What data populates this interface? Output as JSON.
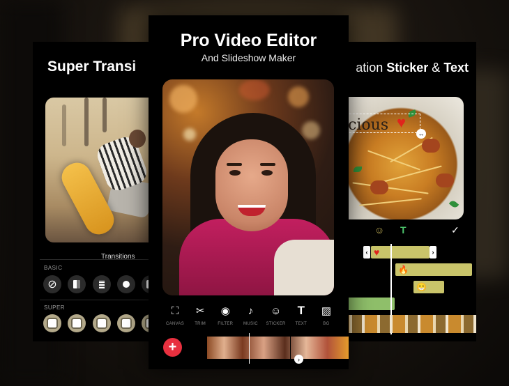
{
  "left_card": {
    "title": "Super Transi",
    "transitions_label": "Transitions",
    "basic_label": "BASIC",
    "super_label": "SUPER"
  },
  "center_card": {
    "title": "Pro Video Editor",
    "subtitle": "And Slideshow Maker",
    "toolbar": [
      {
        "label": "CANVAS",
        "icon": "canvas-icon",
        "glyph": "⛶"
      },
      {
        "label": "TRIM",
        "icon": "scissors-icon",
        "glyph": "✂"
      },
      {
        "label": "FILTER",
        "icon": "filter-icon",
        "glyph": "◉"
      },
      {
        "label": "MUSIC",
        "icon": "music-note-icon",
        "glyph": "♪"
      },
      {
        "label": "STICKER",
        "icon": "smiley-icon",
        "glyph": "☺"
      },
      {
        "label": "TEXT",
        "icon": "text-icon",
        "glyph": "T"
      },
      {
        "label": "BG",
        "icon": "background-pattern-icon",
        "glyph": "▨"
      }
    ],
    "add_glyph": "+",
    "next_glyph": "›"
  },
  "right_card": {
    "title_prefix": "ation ",
    "title_bold1": "Sticker",
    "title_amp": " & ",
    "title_bold2": "Text",
    "sticker_text": "licious",
    "heart_glyph": "♥",
    "emoji_icon_glyph": "☺",
    "text_icon_glyph": "T",
    "check_glyph": "✓",
    "bracket_left": "‹",
    "bracket_right": "›",
    "fire_emoji": "🔥",
    "smile_emoji": "😁"
  },
  "colors": {
    "add_button": "#e8303f",
    "track_yellow": "#c9c46a",
    "track_green": "#8fbf6a",
    "super_chip": "#b3a98a",
    "text_icon_green": "#4cc26a"
  }
}
